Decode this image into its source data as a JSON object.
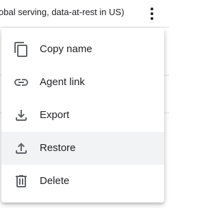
{
  "background": {
    "row_text": "obal serving, data-at-rest in US)",
    "more_actions_icon": "more-vert-icon"
  },
  "menu": {
    "items": [
      {
        "label": "Copy name",
        "icon": "copy-icon",
        "highlighted": false
      },
      {
        "label": "Agent link",
        "icon": "link-icon",
        "highlighted": false
      },
      {
        "label": "Export",
        "icon": "download-icon",
        "highlighted": false
      },
      {
        "label": "Restore",
        "icon": "upload-icon",
        "highlighted": true
      },
      {
        "label": "Delete",
        "icon": "trash-icon",
        "highlighted": false
      }
    ]
  },
  "colors": {
    "text": "#202124",
    "icon": "#5f6368",
    "highlight": "#f1f3f4",
    "divider": "#e0e0e0"
  }
}
